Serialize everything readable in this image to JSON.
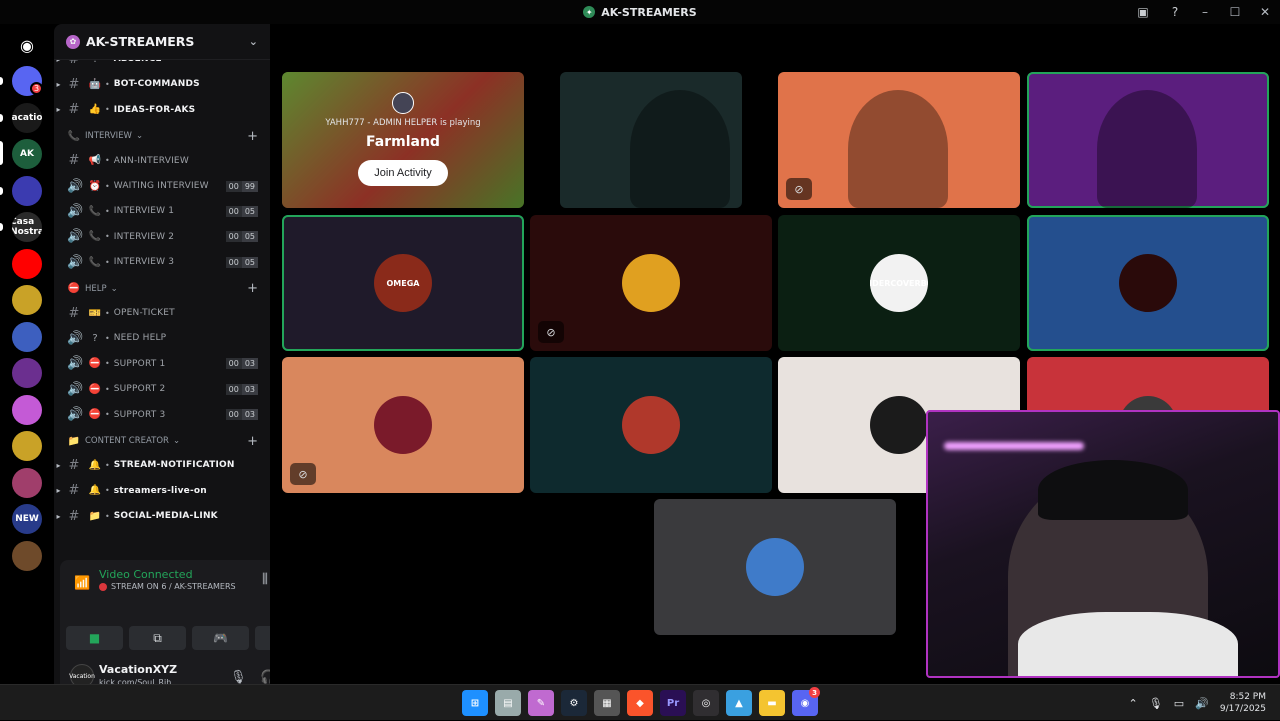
{
  "window": {
    "title": "AK-STREAMERS",
    "title_icon": "discord-server-icon",
    "controls": [
      "minimize-icon",
      "maximize-icon",
      "close-icon"
    ],
    "top_icons": [
      "inbox-icon",
      "help-icon"
    ]
  },
  "guild_rail": {
    "home_icon": "discord-logo-icon",
    "badges": {
      "guild1": "3"
    },
    "servers": [
      {
        "label": "",
        "color": "#5865f2"
      },
      {
        "label": "Vacation",
        "color": "#1a1a1a"
      },
      {
        "label": "AK",
        "color": "#1d5e3c"
      },
      {
        "label": "",
        "color": "#3b3bb0"
      },
      {
        "label": "Casa Nostra",
        "color": "#2a2a2a"
      },
      {
        "label": "",
        "color": "#ff0000"
      },
      {
        "label": "",
        "color": "#c9a227"
      },
      {
        "label": "",
        "color": "#3d5fbf"
      },
      {
        "label": "",
        "color": "#6b2f8f"
      },
      {
        "label": "",
        "color": "#c45ad6"
      },
      {
        "label": "",
        "color": "#c9a227"
      },
      {
        "label": "",
        "color": "#a03e6b"
      },
      {
        "label": "NEW",
        "color": "#283b8a"
      },
      {
        "label": "",
        "color": "#6e4a2a"
      }
    ]
  },
  "server": {
    "name": "AK-STREAMERS"
  },
  "channels": {
    "top": [
      {
        "name": "ABSENCE",
        "emoji": "!",
        "bold": true
      },
      {
        "name": "BOT-COMMANDS",
        "emoji": "🤖",
        "bold": true
      },
      {
        "name": "IDEAS-FOR-AKS",
        "emoji": "👍",
        "bold": true
      }
    ],
    "interview_category": "INTERVIEW",
    "interview": [
      {
        "name": "ANN-INTERVIEW",
        "emoji": "📢",
        "kind": "text",
        "counts": []
      },
      {
        "name": "WAITING INTERVIEW",
        "emoji": "⏰",
        "kind": "voice",
        "counts": [
          "00",
          "99"
        ]
      },
      {
        "name": "INTERVIEW 1",
        "emoji": "📞",
        "kind": "voice",
        "counts": [
          "00",
          "05"
        ]
      },
      {
        "name": "INTERVIEW 2",
        "emoji": "📞",
        "kind": "voice",
        "counts": [
          "00",
          "05"
        ]
      },
      {
        "name": "INTERVIEW 3",
        "emoji": "📞",
        "kind": "voice",
        "counts": [
          "00",
          "05"
        ]
      }
    ],
    "help_category": "HELP",
    "help": [
      {
        "name": "OPEN-TICKET",
        "emoji": "🎫",
        "kind": "text",
        "counts": []
      },
      {
        "name": "NEED HELP",
        "emoji": "?",
        "kind": "voice",
        "counts": []
      },
      {
        "name": "SUPPORT 1",
        "emoji": "⛔",
        "kind": "voice",
        "counts": [
          "00",
          "03"
        ]
      },
      {
        "name": "SUPPORT 2",
        "emoji": "⛔",
        "kind": "voice",
        "counts": [
          "00",
          "03"
        ]
      },
      {
        "name": "SUPPORT 3",
        "emoji": "⛔",
        "kind": "voice",
        "counts": [
          "00",
          "03"
        ]
      }
    ],
    "creator_category": "Content Creator",
    "creator": [
      {
        "name": "STREAM-NOTIFICATION",
        "emoji": "🔔",
        "bold": true
      },
      {
        "name": "streamers-live-on",
        "emoji": "🔔",
        "bold": true
      },
      {
        "name": "SOCIAL-MEDIA-LINK",
        "emoji": "📁",
        "bold": true
      }
    ]
  },
  "voice_panel": {
    "status": "Video Connected",
    "sub": "STREAM ON 6 / AK-STREAMERS",
    "icons": [
      "signal-icon",
      "noise-suppression-icon",
      "disconnect-icon"
    ],
    "buttons": [
      "camera-icon",
      "screen-share-icon",
      "activity-icon",
      "soundboard-icon"
    ]
  },
  "user": {
    "name": "VacationXYZ",
    "status": "kick.com/Soul_Rih",
    "avatar_text": "Vacation",
    "icons": [
      "microphone-icon",
      "headphones-icon",
      "settings-icon"
    ]
  },
  "activity": {
    "playing": "YAHH777 - ADMIN HELPER is playing",
    "game": "Farmland",
    "join_label": "Join Activity"
  },
  "tiles": [
    {
      "id": "activity",
      "bg": "#6fb33c",
      "speaking": false,
      "muted": false,
      "avatar_text": ""
    },
    {
      "id": "cam1",
      "bg": "#1a2a2a",
      "speaking": false,
      "muted": false,
      "avatar_text": ""
    },
    {
      "id": "cam2",
      "bg": "#e0734a",
      "speaking": false,
      "muted": true,
      "avatar_text": ""
    },
    {
      "id": "cam3",
      "bg": "#5b1e7e",
      "speaking": true,
      "muted": false,
      "avatar_text": ""
    },
    {
      "id": "user5",
      "bg": "#1f1a2a",
      "speaking": true,
      "muted": false,
      "avatar_text": "OMEGA"
    },
    {
      "id": "user6",
      "bg": "#2a0b0b",
      "speaking": false,
      "muted": true,
      "avatar_text": ""
    },
    {
      "id": "user7",
      "bg": "#0b1f12",
      "speaking": false,
      "muted": false,
      "avatar_text": "UNDERCOVERBOY"
    },
    {
      "id": "user8",
      "bg": "#244f8e",
      "speaking": true,
      "muted": false,
      "avatar_text": ""
    },
    {
      "id": "user9",
      "bg": "#d9875d",
      "speaking": false,
      "muted": true,
      "avatar_text": ""
    },
    {
      "id": "user10",
      "bg": "#0e2a2e",
      "speaking": false,
      "muted": false,
      "avatar_text": ""
    },
    {
      "id": "user11",
      "bg": "#e8e2de",
      "speaking": false,
      "muted": false,
      "avatar_text": ""
    },
    {
      "id": "user12",
      "bg": "#c8333a",
      "speaking": false,
      "muted": false,
      "avatar_text": ""
    },
    {
      "id": "user13",
      "bg": "#3a3a3d",
      "speaking": false,
      "muted": false,
      "avatar_text": ""
    }
  ],
  "taskbar": {
    "apps": [
      "windows-start-icon",
      "file-icon",
      "notes-icon",
      "steam-icon",
      "calculator-icon",
      "brave-icon",
      "premiere-icon",
      "obs-icon",
      "photos-icon",
      "file-explorer-icon",
      "discord-icon"
    ],
    "app_labels": {
      "premiere": "Pr"
    },
    "discord_badge": "3",
    "time": "8:52 PM",
    "date": "9/17/2025",
    "tray": [
      "chevron-up-icon",
      "microphone-icon",
      "network-icon",
      "volume-icon"
    ]
  }
}
